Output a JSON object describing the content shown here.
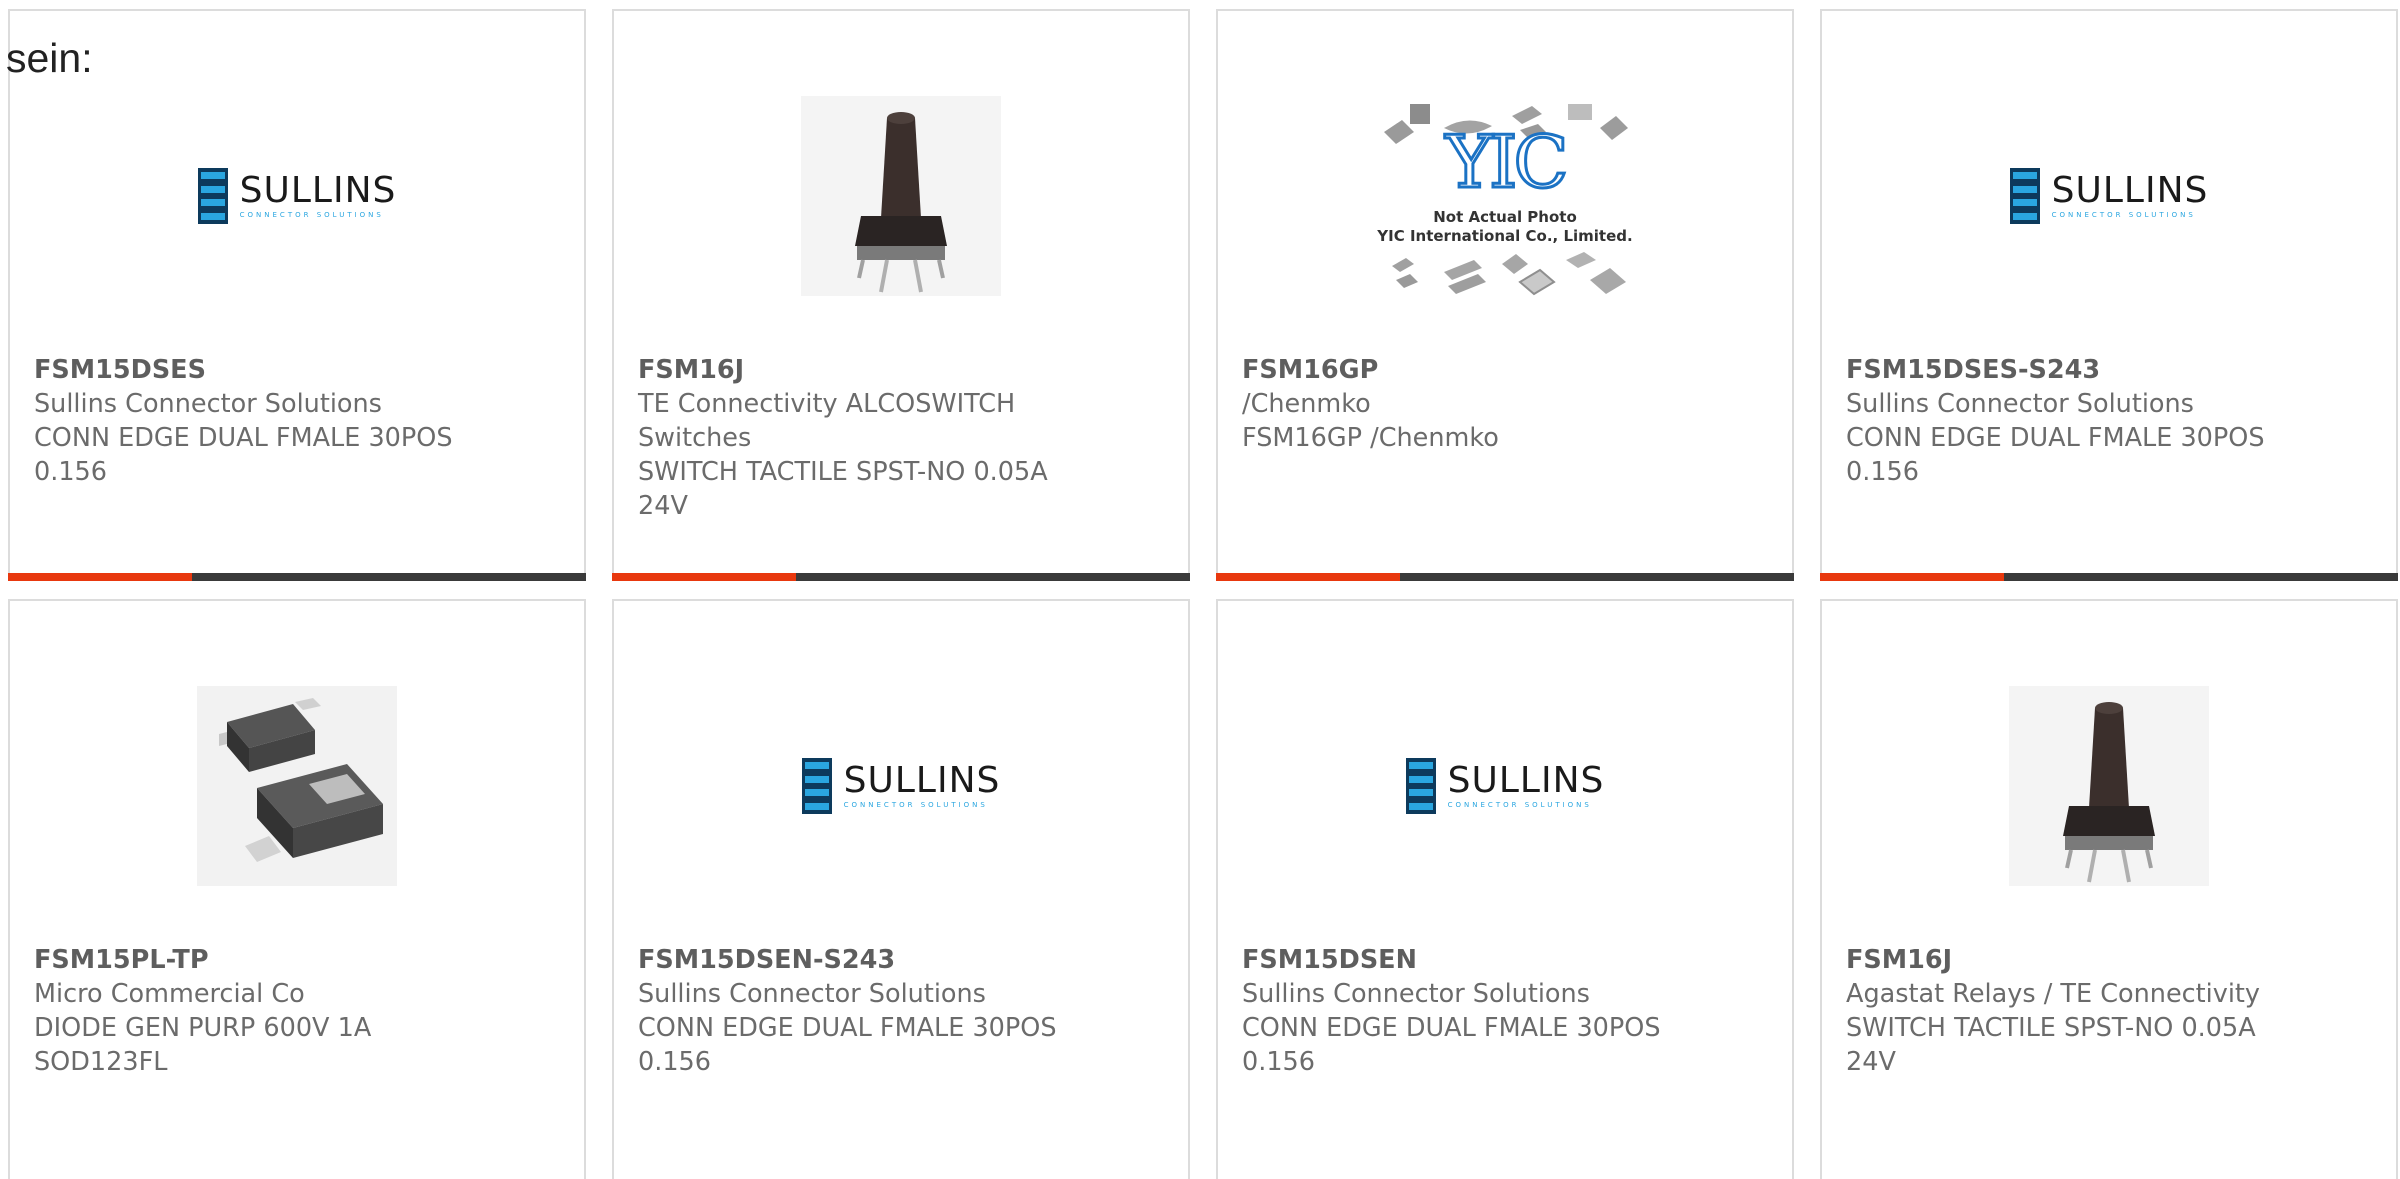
{
  "header": {
    "lead_text": "sein:"
  },
  "brand_logo": {
    "sullins_name": "SULLINS",
    "sullins_tagline": "CONNECTOR SOLUTIONS"
  },
  "placeholder_photo": {
    "logo_text": "YIC",
    "line1": "Not Actual Photo",
    "line2": "YIC International Co., Limited."
  },
  "accent_color": "#e8380e",
  "bar_color": "#3a3a3a",
  "products": [
    {
      "part_number": "FSM15DSES",
      "manufacturer": "Sullins Connector Solutions",
      "desc1": "CONN EDGE DUAL FMALE 30POS",
      "desc2": "0.156",
      "image": "sullins-logo"
    },
    {
      "part_number": "FSM16J",
      "manufacturer": "TE Connectivity ALCOSWITCH",
      "desc1": "Switches",
      "desc2": "SWITCH TACTILE SPST-NO 0.05A",
      "desc3": "24V",
      "image": "tactile-switch-photo"
    },
    {
      "part_number": "FSM16GP",
      "manufacturer": "/Chenmko",
      "desc1": "FSM16GP /Chenmko",
      "image": "yic-placeholder"
    },
    {
      "part_number": "FSM15DSES-S243",
      "manufacturer": "Sullins Connector Solutions",
      "desc1": "CONN EDGE DUAL FMALE 30POS",
      "desc2": "0.156",
      "image": "sullins-logo"
    },
    {
      "part_number": "FSM15PL-TP",
      "manufacturer": "Micro Commercial Co",
      "desc1": "DIODE GEN PURP 600V 1A",
      "desc2": "SOD123FL",
      "image": "diode-photo"
    },
    {
      "part_number": "FSM15DSEN-S243",
      "manufacturer": "Sullins Connector Solutions",
      "desc1": "CONN EDGE DUAL FMALE 30POS",
      "desc2": "0.156",
      "image": "sullins-logo"
    },
    {
      "part_number": "FSM15DSEN",
      "manufacturer": "Sullins Connector Solutions",
      "desc1": "CONN EDGE DUAL FMALE 30POS",
      "desc2": "0.156",
      "image": "sullins-logo"
    },
    {
      "part_number": "FSM16J",
      "manufacturer": "Agastat Relays / TE Connectivity",
      "desc1": "SWITCH TACTILE SPST-NO 0.05A",
      "desc2": "24V",
      "image": "tactile-switch-photo"
    }
  ]
}
